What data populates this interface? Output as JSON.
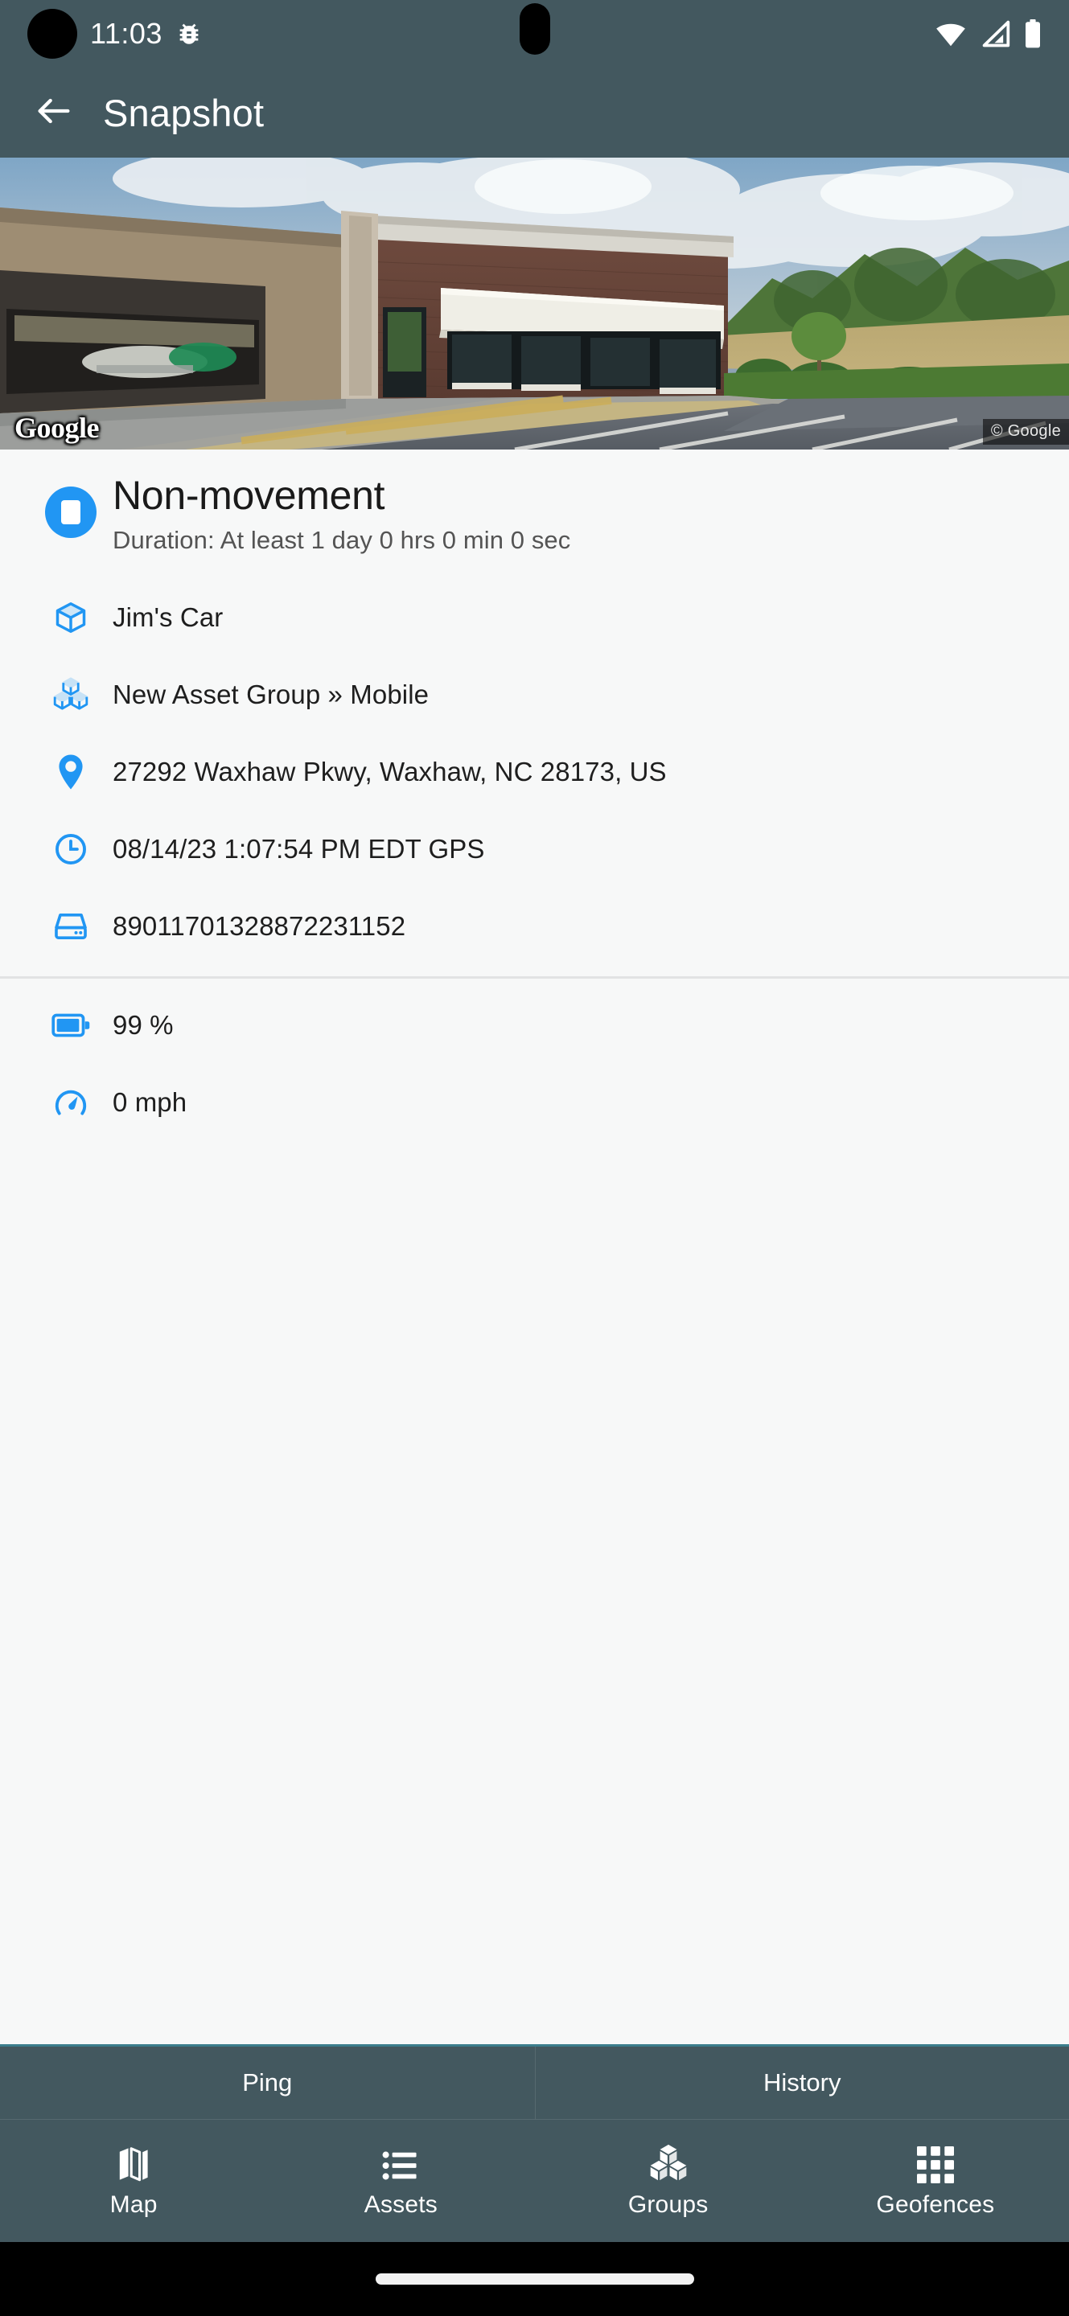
{
  "status_bar": {
    "time": "11:03",
    "icons": [
      "bug-icon",
      "wifi-icon",
      "cellular-signal-icon",
      "battery-icon"
    ]
  },
  "toolbar": {
    "back_icon": "back-arrow-icon",
    "title": "Snapshot"
  },
  "street_view": {
    "watermark": "Google",
    "attribution": "© Google"
  },
  "event": {
    "icon": "non-movement-stop-icon",
    "title": "Non-movement",
    "duration": "Duration: At least 1 day 0 hrs 0 min 0 sec"
  },
  "details": [
    {
      "icon": "asset-cube-icon",
      "text": "Jim's Car"
    },
    {
      "icon": "group-cubes-icon",
      "text": "New Asset Group » Mobile"
    },
    {
      "icon": "location-pin-icon",
      "text": "27292 Waxhaw Pkwy, Waxhaw, NC 28173, US"
    },
    {
      "icon": "clock-icon",
      "text": "08/14/23 1:07:54 PM EDT GPS"
    },
    {
      "icon": "sim-card-icon",
      "text": "89011701328872231152"
    }
  ],
  "telemetry": [
    {
      "icon": "battery-icon",
      "text": "99 %"
    },
    {
      "icon": "speedometer-icon",
      "text": "0 mph"
    }
  ],
  "actions": [
    {
      "label": "Ping"
    },
    {
      "label": "History"
    }
  ],
  "bottom_nav": {
    "selected": "Map",
    "items": [
      {
        "icon": "map-icon",
        "label": "Map"
      },
      {
        "icon": "list-icon",
        "label": "Assets"
      },
      {
        "icon": "group-cubes-icon",
        "label": "Groups"
      },
      {
        "icon": "grid-icon",
        "label": "Geofences"
      }
    ]
  },
  "colors": {
    "toolbar": "#43585F",
    "accent_blue": "#2196F3",
    "card_bg": "#F7F8F8",
    "divider": "#E2E3E4",
    "action_top_border": "#3B7E8C",
    "text_primary": "#1E1E1E",
    "text_secondary": "#545454"
  }
}
